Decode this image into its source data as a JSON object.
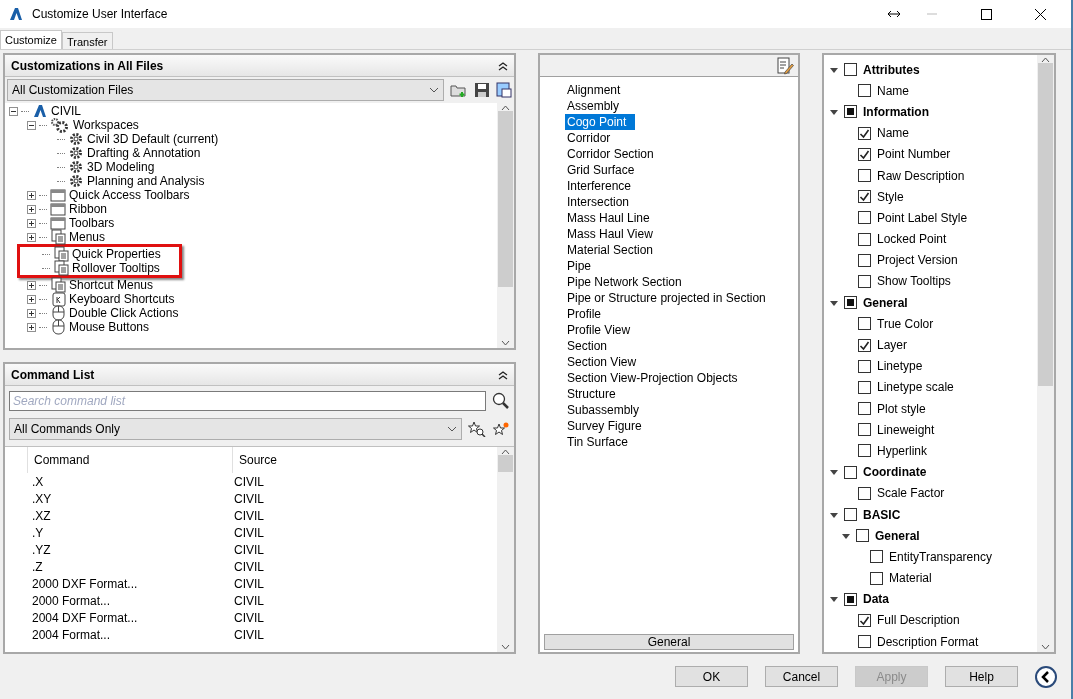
{
  "window": {
    "title": "Customize User Interface"
  },
  "tabs": [
    {
      "label": "Customize",
      "selected": true
    },
    {
      "label": "Transfer",
      "selected": false
    }
  ],
  "customizations": {
    "title": "Customizations in All Files",
    "file_select": "All Customization Files",
    "tree": [
      {
        "label": "CIVIL",
        "kind": "logo",
        "expanded": true,
        "highlighted": false,
        "children": [
          {
            "label": "Workspaces",
            "kind": "gears",
            "expanded": true,
            "highlighted": false,
            "children": [
              {
                "label": "Civil 3D Default (current)",
                "kind": "gear",
                "highlighted": false
              },
              {
                "label": "Drafting & Annotation",
                "kind": "gear",
                "highlighted": false
              },
              {
                "label": "3D Modeling",
                "kind": "gear",
                "highlighted": false
              },
              {
                "label": "Planning and Analysis",
                "kind": "gear",
                "highlighted": false
              }
            ]
          },
          {
            "label": "Quick Access Toolbars",
            "kind": "window",
            "expanded": false,
            "highlighted": false
          },
          {
            "label": "Ribbon",
            "kind": "window",
            "expanded": false,
            "highlighted": false
          },
          {
            "label": "Toolbars",
            "kind": "window",
            "expanded": false,
            "highlighted": false
          },
          {
            "label": "Menus",
            "kind": "list",
            "expanded": false,
            "highlighted": false
          },
          {
            "label": "Quick Properties",
            "kind": "list",
            "highlighted": true
          },
          {
            "label": "Rollover Tooltips",
            "kind": "list",
            "highlighted": true
          },
          {
            "label": "Shortcut Menus",
            "kind": "list",
            "expanded": false,
            "highlighted": false
          },
          {
            "label": "Keyboard Shortcuts",
            "kind": "key",
            "expanded": false,
            "highlighted": false
          },
          {
            "label": "Double Click Actions",
            "kind": "mouse",
            "expanded": false,
            "highlighted": false
          },
          {
            "label": "Mouse Buttons",
            "kind": "mouse",
            "expanded": false,
            "highlighted": false
          }
        ]
      }
    ]
  },
  "command_list": {
    "title": "Command List",
    "search": {
      "placeholder": "Search command list"
    },
    "filter": "All Commands Only",
    "columns": [
      "Command",
      "Source"
    ],
    "rows": [
      [
        ".X",
        "CIVIL"
      ],
      [
        ".XY",
        "CIVIL"
      ],
      [
        ".XZ",
        "CIVIL"
      ],
      [
        ".Y",
        "CIVIL"
      ],
      [
        ".YZ",
        "CIVIL"
      ],
      [
        ".Z",
        "CIVIL"
      ],
      [
        "2000 DXF Format...",
        "CIVIL"
      ],
      [
        "2000 Format...",
        "CIVIL"
      ],
      [
        "2004 DXF Format...",
        "CIVIL"
      ],
      [
        "2004 Format...",
        "CIVIL"
      ]
    ]
  },
  "object_types": {
    "items": [
      {
        "label": "Alignment",
        "selected": false
      },
      {
        "label": "Assembly",
        "selected": false
      },
      {
        "label": "Cogo Point",
        "selected": true
      },
      {
        "label": "Corridor",
        "selected": false
      },
      {
        "label": "Corridor Section",
        "selected": false
      },
      {
        "label": "Grid Surface",
        "selected": false
      },
      {
        "label": "Interference",
        "selected": false
      },
      {
        "label": "Intersection",
        "selected": false
      },
      {
        "label": "Mass Haul Line",
        "selected": false
      },
      {
        "label": "Mass Haul View",
        "selected": false
      },
      {
        "label": "Material Section",
        "selected": false
      },
      {
        "label": "Pipe",
        "selected": false
      },
      {
        "label": "Pipe Network Section",
        "selected": false
      },
      {
        "label": "Pipe or Structure projected in Section",
        "selected": false
      },
      {
        "label": "Profile",
        "selected": false
      },
      {
        "label": "Profile View",
        "selected": false
      },
      {
        "label": "Section",
        "selected": false
      },
      {
        "label": "Section View",
        "selected": false
      },
      {
        "label": "Section View-Projection Objects",
        "selected": false
      },
      {
        "label": "Structure",
        "selected": false
      },
      {
        "label": "Subassembly",
        "selected": false
      },
      {
        "label": "Survey Figure",
        "selected": false
      },
      {
        "label": "Tin Surface",
        "selected": false
      }
    ],
    "footer": "General"
  },
  "properties": [
    {
      "label": "Attributes",
      "checked": false,
      "indeterminate": false,
      "expanded": true,
      "children": [
        {
          "label": "Name",
          "checked": false
        }
      ]
    },
    {
      "label": "Information",
      "checked": false,
      "indeterminate": true,
      "expanded": true,
      "children": [
        {
          "label": "Name",
          "checked": true
        },
        {
          "label": "Point Number",
          "checked": true
        },
        {
          "label": "Raw Description",
          "checked": false
        },
        {
          "label": "Style",
          "checked": true
        },
        {
          "label": "Point Label Style",
          "checked": false
        },
        {
          "label": "Locked Point",
          "checked": false
        },
        {
          "label": "Project Version",
          "checked": false
        },
        {
          "label": "Show Tooltips",
          "checked": false
        }
      ]
    },
    {
      "label": "General",
      "checked": false,
      "indeterminate": true,
      "expanded": true,
      "children": [
        {
          "label": "True Color",
          "checked": false
        },
        {
          "label": "Layer",
          "checked": true
        },
        {
          "label": "Linetype",
          "checked": false
        },
        {
          "label": "Linetype scale",
          "checked": false
        },
        {
          "label": "Plot style",
          "checked": false
        },
        {
          "label": "Lineweight",
          "checked": false
        },
        {
          "label": "Hyperlink",
          "checked": false
        }
      ]
    },
    {
      "label": "Coordinate",
      "checked": false,
      "indeterminate": false,
      "expanded": true,
      "children": [
        {
          "label": "Scale Factor",
          "checked": false
        }
      ]
    },
    {
      "label": "BASIC",
      "checked": false,
      "indeterminate": false,
      "expanded": true,
      "children": [
        {
          "label": "General",
          "checked": false,
          "indeterminate": false,
          "expanded": true,
          "children": [
            {
              "label": "EntityTransparency",
              "checked": false
            },
            {
              "label": "Material",
              "checked": false
            }
          ]
        }
      ]
    },
    {
      "label": "Data",
      "checked": false,
      "indeterminate": true,
      "expanded": true,
      "children": [
        {
          "label": "Full Description",
          "checked": true
        },
        {
          "label": "Description Format",
          "checked": false
        }
      ]
    }
  ],
  "buttons": [
    {
      "label": "OK",
      "disabled": false
    },
    {
      "label": "Cancel",
      "disabled": false
    },
    {
      "label": "Apply",
      "disabled": true
    },
    {
      "label": "Help",
      "disabled": false
    }
  ]
}
